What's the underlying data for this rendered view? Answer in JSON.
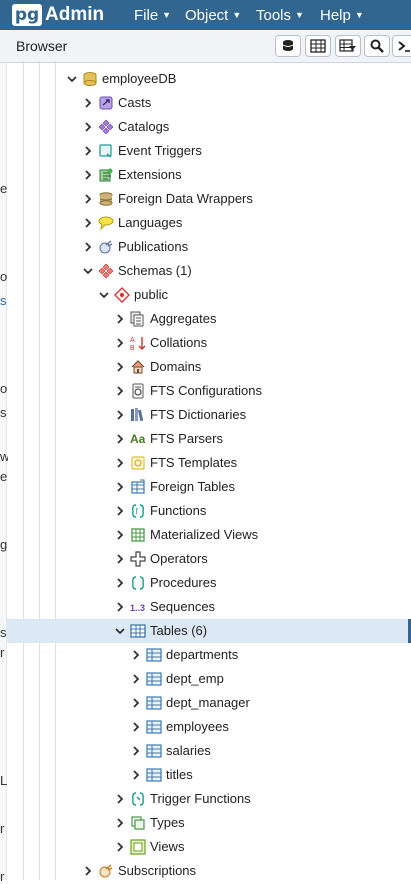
{
  "app": {
    "logo_pg": "pg",
    "logo_admin": "Admin"
  },
  "menu": [
    {
      "label": "File"
    },
    {
      "label": "Object"
    },
    {
      "label": "Tools"
    },
    {
      "label": "Help"
    }
  ],
  "browser": {
    "title": "Browser"
  },
  "toolbar": {
    "icons": [
      "database-icon",
      "table-grid-icon",
      "filtered-rows-icon",
      "search-icon",
      "terminal-icon"
    ]
  },
  "colors": {
    "accent": "#326690",
    "selected_row": "#dde8f5"
  },
  "gutter_fragments": [
    "e",
    "o",
    "s",
    "o",
    "s",
    "w",
    "e",
    "g",
    "s",
    "r",
    "L",
    "r",
    "r"
  ],
  "tree": [
    {
      "label": "employeeDB",
      "depth": 0,
      "expanded": true,
      "icon": "database-icon"
    },
    {
      "label": "Casts",
      "depth": 1,
      "expanded": false,
      "icon": "casts-icon"
    },
    {
      "label": "Catalogs",
      "depth": 1,
      "expanded": false,
      "icon": "catalogs-icon"
    },
    {
      "label": "Event Triggers",
      "depth": 1,
      "expanded": false,
      "icon": "event-triggers-icon"
    },
    {
      "label": "Extensions",
      "depth": 1,
      "expanded": false,
      "icon": "extensions-icon"
    },
    {
      "label": "Foreign Data Wrappers",
      "depth": 1,
      "expanded": false,
      "icon": "foreign-data-wrappers-icon"
    },
    {
      "label": "Languages",
      "depth": 1,
      "expanded": false,
      "icon": "languages-icon"
    },
    {
      "label": "Publications",
      "depth": 1,
      "expanded": false,
      "icon": "publications-icon"
    },
    {
      "label": "Schemas (1)",
      "depth": 1,
      "expanded": true,
      "icon": "schemas-icon"
    },
    {
      "label": "public",
      "depth": 2,
      "expanded": true,
      "icon": "schema-icon"
    },
    {
      "label": "Aggregates",
      "depth": 3,
      "expanded": false,
      "icon": "aggregates-icon"
    },
    {
      "label": "Collations",
      "depth": 3,
      "expanded": false,
      "icon": "collations-icon"
    },
    {
      "label": "Domains",
      "depth": 3,
      "expanded": false,
      "icon": "domains-icon"
    },
    {
      "label": "FTS Configurations",
      "depth": 3,
      "expanded": false,
      "icon": "fts-configurations-icon"
    },
    {
      "label": "FTS Dictionaries",
      "depth": 3,
      "expanded": false,
      "icon": "fts-dictionaries-icon"
    },
    {
      "label": "FTS Parsers",
      "depth": 3,
      "expanded": false,
      "icon": "fts-parsers-icon"
    },
    {
      "label": "FTS Templates",
      "depth": 3,
      "expanded": false,
      "icon": "fts-templates-icon"
    },
    {
      "label": "Foreign Tables",
      "depth": 3,
      "expanded": false,
      "icon": "foreign-tables-icon"
    },
    {
      "label": "Functions",
      "depth": 3,
      "expanded": false,
      "icon": "functions-icon"
    },
    {
      "label": "Materialized Views",
      "depth": 3,
      "expanded": false,
      "icon": "materialized-views-icon"
    },
    {
      "label": "Operators",
      "depth": 3,
      "expanded": false,
      "icon": "operators-icon"
    },
    {
      "label": "Procedures",
      "depth": 3,
      "expanded": false,
      "icon": "procedures-icon"
    },
    {
      "label": "Sequences",
      "depth": 3,
      "expanded": false,
      "icon": "sequences-icon"
    },
    {
      "label": "Tables (6)",
      "depth": 3,
      "expanded": true,
      "icon": "tables-icon",
      "selected": true
    },
    {
      "label": "departments",
      "depth": 4,
      "expanded": false,
      "icon": "table-icon"
    },
    {
      "label": "dept_emp",
      "depth": 4,
      "expanded": false,
      "icon": "table-icon"
    },
    {
      "label": "dept_manager",
      "depth": 4,
      "expanded": false,
      "icon": "table-icon"
    },
    {
      "label": "employees",
      "depth": 4,
      "expanded": false,
      "icon": "table-icon"
    },
    {
      "label": "salaries",
      "depth": 4,
      "expanded": false,
      "icon": "table-icon"
    },
    {
      "label": "titles",
      "depth": 4,
      "expanded": false,
      "icon": "table-icon"
    },
    {
      "label": "Trigger Functions",
      "depth": 3,
      "expanded": false,
      "icon": "trigger-functions-icon"
    },
    {
      "label": "Types",
      "depth": 3,
      "expanded": false,
      "icon": "types-icon"
    },
    {
      "label": "Views",
      "depth": 3,
      "expanded": false,
      "icon": "views-icon"
    },
    {
      "label": "Subscriptions",
      "depth": 1,
      "expanded": false,
      "icon": "subscriptions-icon"
    }
  ]
}
